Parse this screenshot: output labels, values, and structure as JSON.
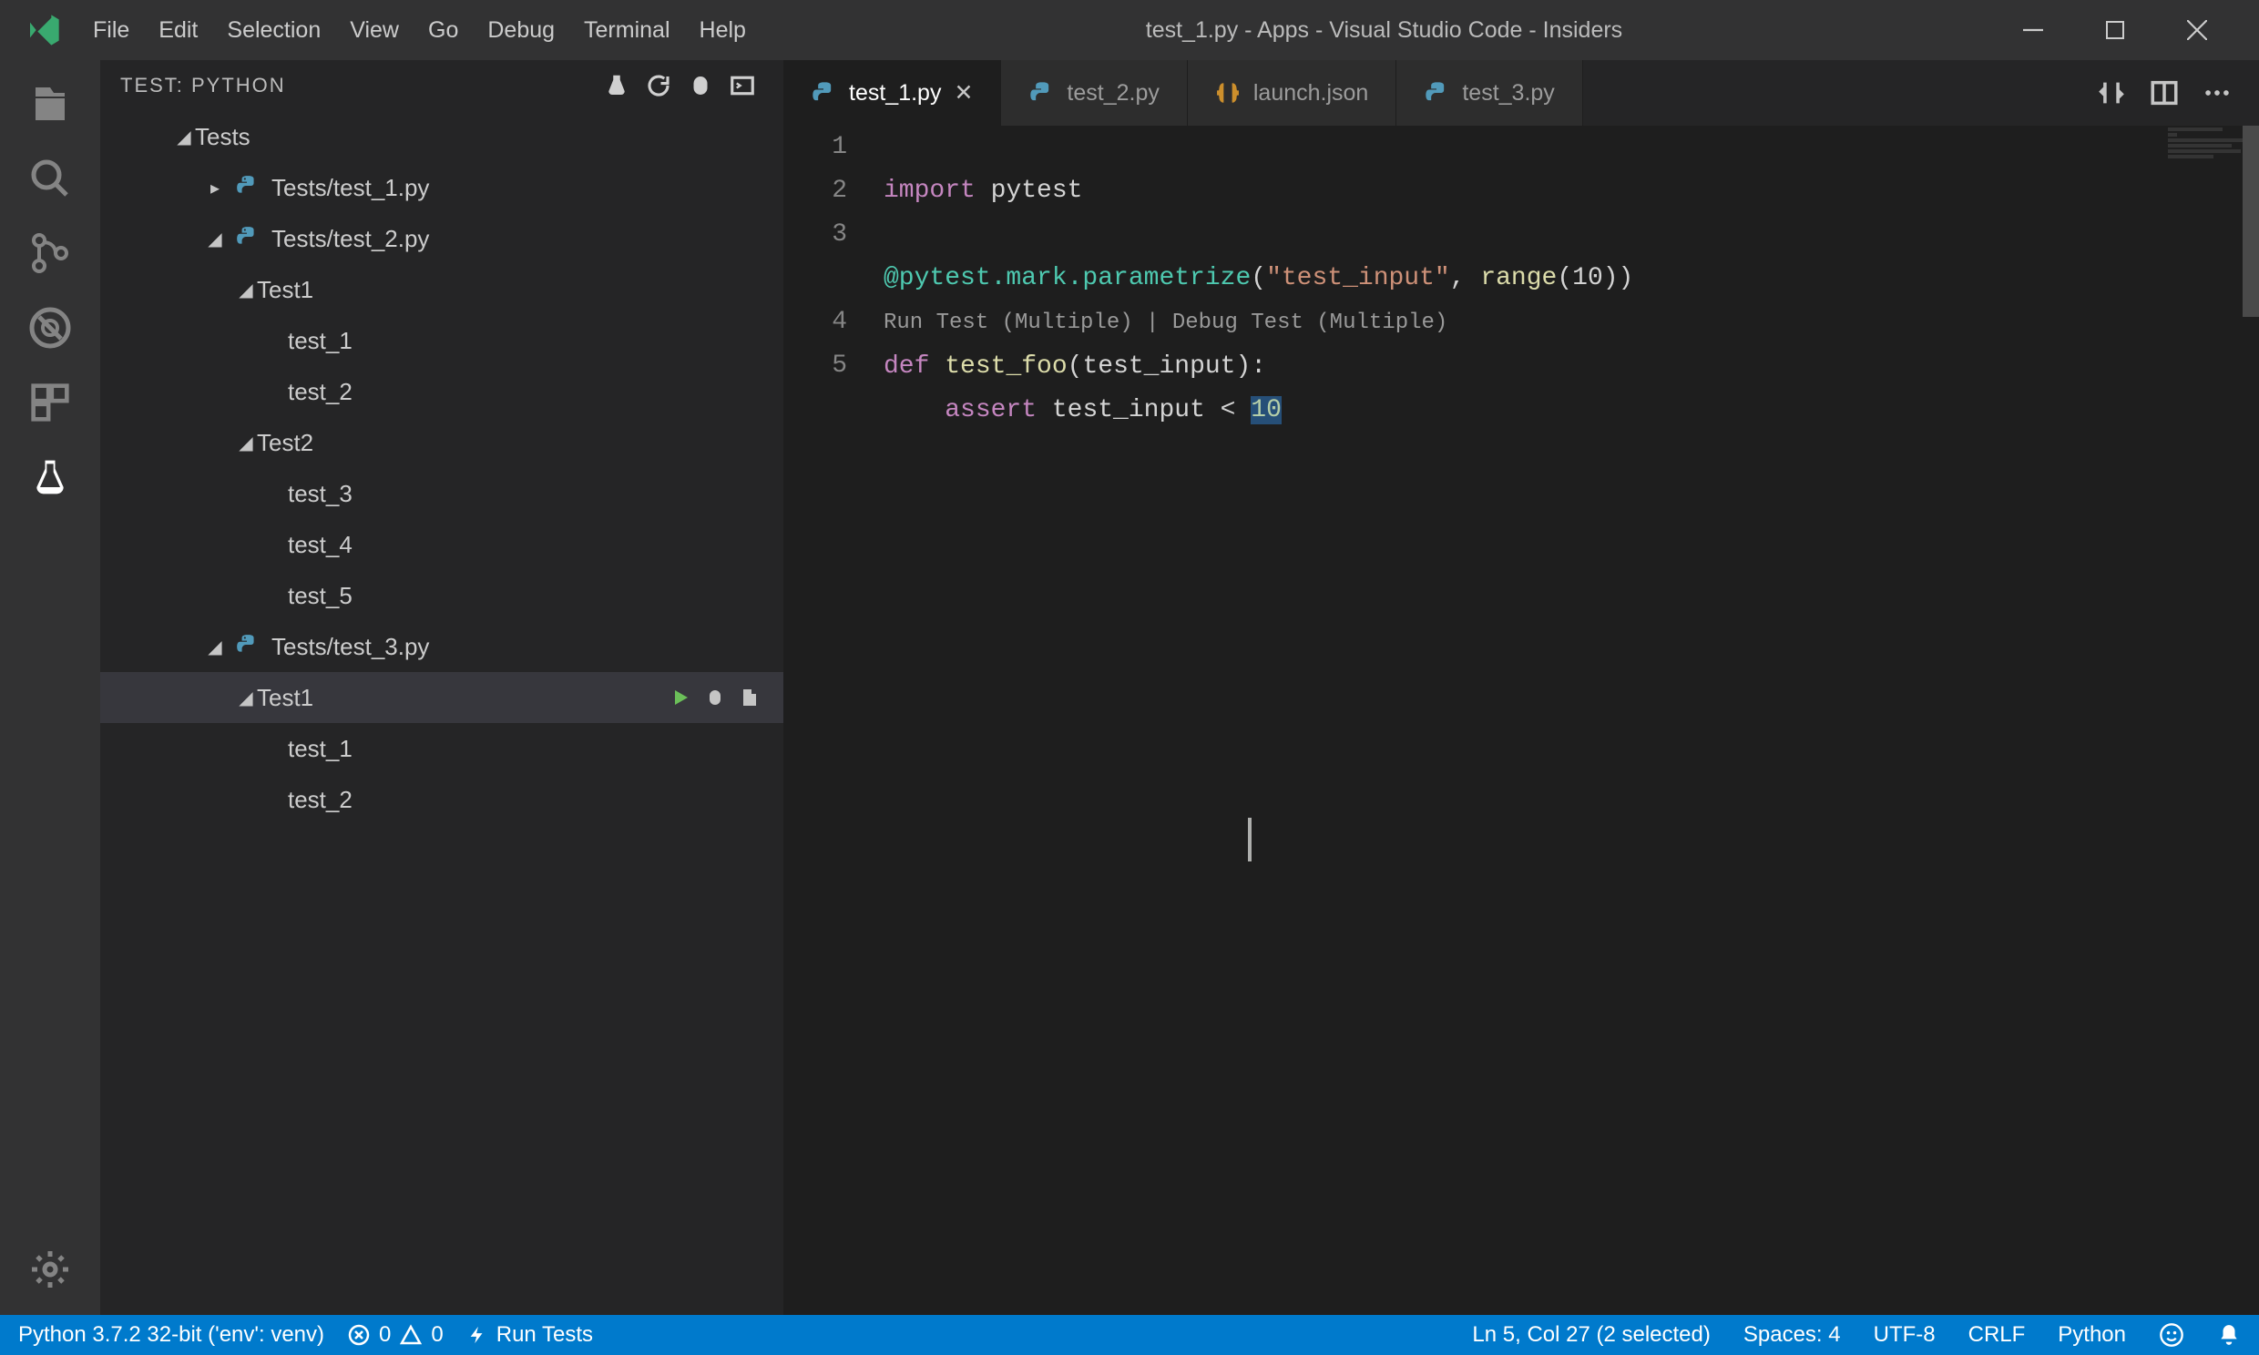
{
  "menubar": {
    "items": [
      "File",
      "Edit",
      "Selection",
      "View",
      "Go",
      "Debug",
      "Terminal",
      "Help"
    ],
    "title": "test_1.py - Apps - Visual Studio Code - Insiders"
  },
  "sidebar": {
    "title": "TEST: PYTHON",
    "tree": [
      {
        "depth": 0,
        "expand": "down",
        "icon": "",
        "label": "Tests"
      },
      {
        "depth": 1,
        "expand": "right",
        "icon": "py",
        "label": "Tests/test_1.py"
      },
      {
        "depth": 1,
        "expand": "down",
        "icon": "py",
        "label": "Tests/test_2.py"
      },
      {
        "depth": 2,
        "expand": "down",
        "icon": "",
        "label": "Test1"
      },
      {
        "depth": 3,
        "expand": "",
        "icon": "",
        "label": "test_1"
      },
      {
        "depth": 3,
        "expand": "",
        "icon": "",
        "label": "test_2"
      },
      {
        "depth": 2,
        "expand": "down",
        "icon": "",
        "label": "Test2"
      },
      {
        "depth": 3,
        "expand": "",
        "icon": "",
        "label": "test_3"
      },
      {
        "depth": 3,
        "expand": "",
        "icon": "",
        "label": "test_4"
      },
      {
        "depth": 3,
        "expand": "",
        "icon": "",
        "label": "test_5"
      },
      {
        "depth": 1,
        "expand": "down",
        "icon": "py",
        "label": "Tests/test_3.py"
      },
      {
        "depth": 2,
        "expand": "down",
        "icon": "",
        "label": "Test1",
        "selected": true,
        "actions": true
      },
      {
        "depth": 3,
        "expand": "",
        "icon": "",
        "label": "test_1"
      },
      {
        "depth": 3,
        "expand": "",
        "icon": "",
        "label": "test_2"
      }
    ]
  },
  "tabs": [
    {
      "icon": "py",
      "label": "test_1.py",
      "active": true,
      "close": true
    },
    {
      "icon": "py",
      "label": "test_2.py",
      "active": false,
      "close": false
    },
    {
      "icon": "json",
      "label": "launch.json",
      "active": false,
      "close": false
    },
    {
      "icon": "py",
      "label": "test_3.py",
      "active": false,
      "close": false
    }
  ],
  "editor": {
    "codelens": "Run Test (Multiple) | Debug Test (Multiple)",
    "lines": {
      "l1_kw": "import",
      "l1_mod": "pytest",
      "l3_dec": "@pytest.mark.parametrize",
      "l3_open": "(",
      "l3_str": "\"test_input\"",
      "l3_sep": ", ",
      "l3_fn": "range",
      "l3_args": "(10))",
      "l4_kw": "def",
      "l4_fn": "test_foo",
      "l4_sig": "(test_input):",
      "l5_pre": "    ",
      "l5_kw": "assert",
      "l5_rest": " test_input < ",
      "l5_num": "10"
    }
  },
  "statusbar": {
    "python": "Python 3.7.2 32-bit ('env': venv)",
    "errors": "0",
    "warnings": "0",
    "runtests": "Run Tests",
    "pos": "Ln 5, Col 27 (2 selected)",
    "spaces": "Spaces: 4",
    "encoding": "UTF-8",
    "eol": "CRLF",
    "lang": "Python"
  }
}
